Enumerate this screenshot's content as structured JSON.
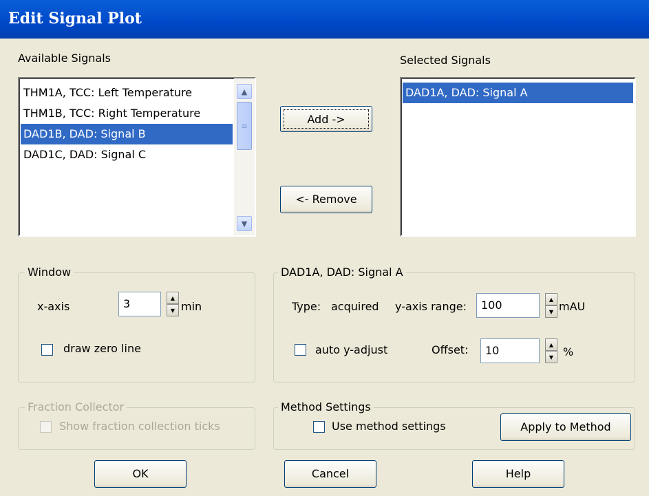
{
  "window": {
    "title": "Edit Signal Plot"
  },
  "available": {
    "label": "Available Signals",
    "items": [
      "THM1A, TCC: Left Temperature",
      "THM1B, TCC: Right Temperature",
      "DAD1B, DAD: Signal B",
      "DAD1C, DAD: Signal C"
    ],
    "selected_index": 2
  },
  "selected": {
    "label": "Selected Signals",
    "items": [
      "DAD1A, DAD: Signal A"
    ]
  },
  "buttons": {
    "add": "Add ->",
    "remove": "<- Remove",
    "apply": "Apply to Method",
    "ok": "OK",
    "cancel": "Cancel",
    "help": "Help"
  },
  "window_group": {
    "title": "Window",
    "xaxis_label": "x-axis",
    "xaxis_value": "3",
    "xaxis_unit": "min",
    "draw_zero_line": "draw zero line",
    "draw_zero_line_checked": false
  },
  "signal_group": {
    "title": "DAD1A, DAD: Signal A",
    "type_label": "Type:",
    "type_value": "acquired",
    "yrange_label": "y-axis range:",
    "yrange_value": "100",
    "yrange_unit": "mAU",
    "auto_adjust": "auto y-adjust",
    "auto_adjust_checked": false,
    "offset_label": "Offset:",
    "offset_value": "10",
    "offset_unit": "%"
  },
  "fraction_group": {
    "title": "Fraction Collector",
    "show_ticks": "Show fraction collection ticks",
    "show_ticks_checked": false,
    "disabled": true
  },
  "method_group": {
    "title": "Method Settings",
    "use_method": "Use method settings",
    "use_method_checked": false
  }
}
